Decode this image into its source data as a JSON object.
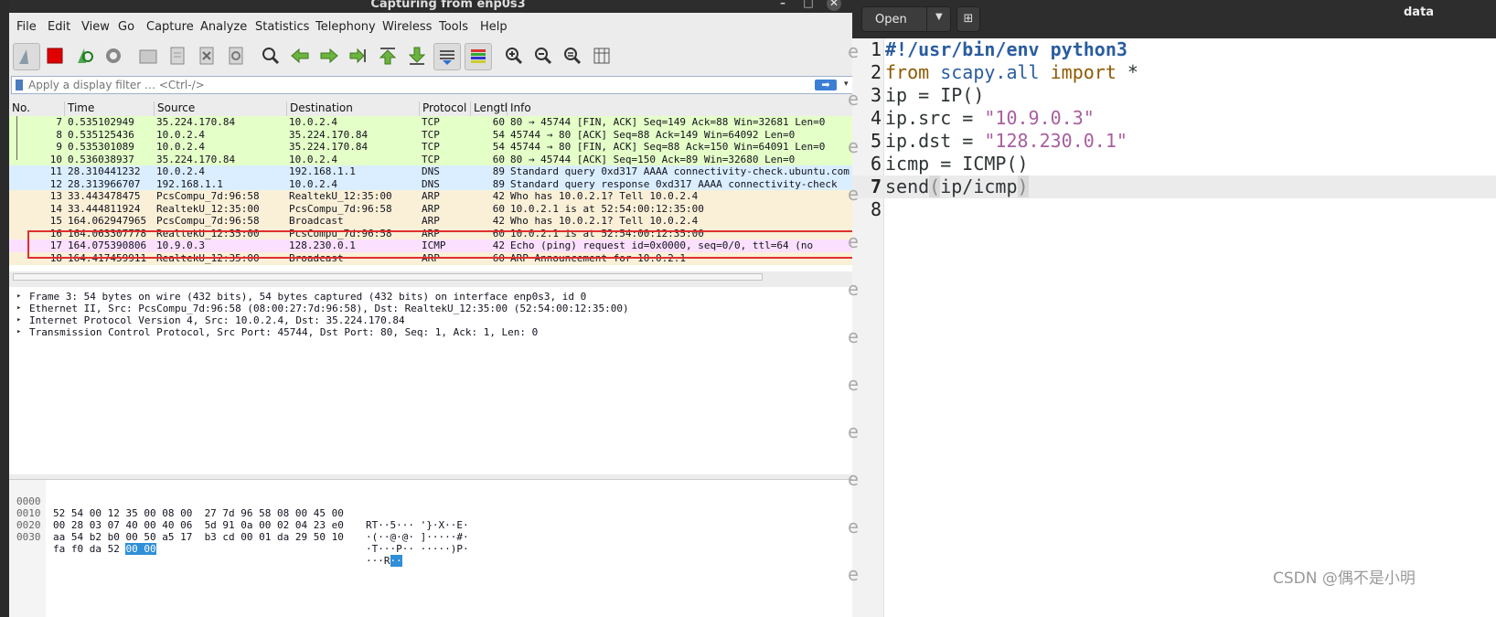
{
  "wireshark": {
    "title": "Capturing from enp0s3",
    "window_controls": {
      "minimize": "–",
      "maximize": "□",
      "close": "✕"
    },
    "menu": [
      "File",
      "Edit",
      "View",
      "Go",
      "Capture",
      "Analyze",
      "Statistics",
      "Telephony",
      "Wireless",
      "Tools",
      "Help"
    ],
    "toolbar_icons": [
      "shark-fin-start-icon",
      "stop-capture-icon",
      "restart-capture-icon",
      "capture-options-gear-icon",
      "open-file-icon",
      "save-file-icon",
      "close-file-icon",
      "reload-file-icon",
      "find-packet-icon",
      "go-back-icon",
      "go-forward-icon",
      "go-to-packet-icon",
      "go-first-icon",
      "go-last-icon",
      "autoscroll-icon",
      "colorize-icon",
      "zoom-in-icon",
      "zoom-out-icon",
      "zoom-normal-icon",
      "resize-columns-icon"
    ],
    "filter": {
      "placeholder": "Apply a display filter … <Ctrl-/>",
      "apply": "➡",
      "dropdown": "▾",
      "add": "+"
    },
    "columns": [
      "No.",
      "Time",
      "Source",
      "Destination",
      "Protocol",
      "Length",
      "Info"
    ],
    "packets": [
      {
        "no": "7",
        "time": "0.535102949",
        "src": "35.224.170.84",
        "dst": "10.0.2.4",
        "proto": "TCP",
        "len": "60",
        "info": "80 → 45744 [FIN, ACK] Seq=149 Ack=88 Win=32681 Len=0",
        "bg": "#e4ffc7"
      },
      {
        "no": "8",
        "time": "0.535125436",
        "src": "10.0.2.4",
        "dst": "35.224.170.84",
        "proto": "TCP",
        "len": "54",
        "info": "45744 → 80 [ACK] Seq=88 Ack=149 Win=64092 Len=0",
        "bg": "#e4ffc7"
      },
      {
        "no": "9",
        "time": "0.535301089",
        "src": "10.0.2.4",
        "dst": "35.224.170.84",
        "proto": "TCP",
        "len": "54",
        "info": "45744 → 80 [FIN, ACK] Seq=88 Ack=150 Win=64091 Len=0",
        "bg": "#e4ffc7"
      },
      {
        "no": "10",
        "time": "0.536038937",
        "src": "35.224.170.84",
        "dst": "10.0.2.4",
        "proto": "TCP",
        "len": "60",
        "info": "80 → 45744 [ACK] Seq=150 Ack=89 Win=32680 Len=0",
        "bg": "#e4ffc7"
      },
      {
        "no": "11",
        "time": "28.310441232",
        "src": "10.0.2.4",
        "dst": "192.168.1.1",
        "proto": "DNS",
        "len": "89",
        "info": "Standard query 0xd317 AAAA connectivity-check.ubuntu.com",
        "bg": "#daeeff"
      },
      {
        "no": "12",
        "time": "28.313966707",
        "src": "192.168.1.1",
        "dst": "10.0.2.4",
        "proto": "DNS",
        "len": "89",
        "info": "Standard query response 0xd317 AAAA connectivity-check",
        "bg": "#daeeff"
      },
      {
        "no": "13",
        "time": "33.443478475",
        "src": "PcsCompu_7d:96:58",
        "dst": "RealtekU_12:35:00",
        "proto": "ARP",
        "len": "42",
        "info": "Who has 10.0.2.1? Tell 10.0.2.4",
        "bg": "#faf0d7"
      },
      {
        "no": "14",
        "time": "33.444811924",
        "src": "RealtekU_12:35:00",
        "dst": "PcsCompu_7d:96:58",
        "proto": "ARP",
        "len": "60",
        "info": "10.0.2.1 is at 52:54:00:12:35:00",
        "bg": "#faf0d7"
      },
      {
        "no": "15",
        "time": "164.062947965",
        "src": "PcsCompu_7d:96:58",
        "dst": "Broadcast",
        "proto": "ARP",
        "len": "42",
        "info": "Who has 10.0.2.1? Tell 10.0.2.4",
        "bg": "#faf0d7"
      },
      {
        "no": "16",
        "time": "164.063307778",
        "src": "RealtekU_12:35:00",
        "dst": "PcsCompu_7d:96:58",
        "proto": "ARP",
        "len": "60",
        "info": "10.0.2.1 is at 52:54:00:12:35:00",
        "bg": "#faf0d7"
      },
      {
        "no": "17",
        "time": "164.075390806",
        "src": "10.9.0.3",
        "dst": "128.230.0.1",
        "proto": "ICMP",
        "len": "42",
        "info": "Echo (ping) request  id=0x0000, seq=0/0, ttl=64 (no",
        "bg": "#fce0ff"
      },
      {
        "no": "18",
        "time": "164.417459911",
        "src": "RealtekU_12:35:00",
        "dst": "Broadcast",
        "proto": "ARP",
        "len": "60",
        "info": "ARP Announcement for 10.0.2.1",
        "bg": "#faf0d7"
      }
    ],
    "details": [
      "Frame 3: 54 bytes on wire (432 bits), 54 bytes captured (432 bits) on interface enp0s3, id 0",
      "Ethernet II, Src: PcsCompu_7d:96:58 (08:00:27:7d:96:58), Dst: RealtekU_12:35:00 (52:54:00:12:35:00)",
      "Internet Protocol Version 4, Src: 10.0.2.4, Dst: 35.224.170.84",
      "Transmission Control Protocol, Src Port: 45744, Dst Port: 80, Seq: 1, Ack: 1, Len: 0"
    ],
    "bytes": [
      {
        "offset": "0000",
        "hex": "52 54 00 12 35 00 08 00  27 7d 96 58 08 00 45 00",
        "hex_sel": "",
        "ascii": "RT··5··· '}·X··E·",
        "ascii_sel": ""
      },
      {
        "offset": "0010",
        "hex": "00 28 03 07 40 00 40 06  5d 91 0a 00 02 04 23 e0",
        "hex_sel": "",
        "ascii": "·(··@·@· ]·····#·",
        "ascii_sel": ""
      },
      {
        "offset": "0020",
        "hex": "aa 54 b2 b0 00 50 a5 17  b3 cd 00 01 da 29 50 10",
        "hex_sel": "",
        "ascii": "·T···P·· ·····)P·",
        "ascii_sel": ""
      },
      {
        "offset": "0030",
        "hex": "fa f0 da 52 ",
        "hex_sel": "00 00",
        "ascii": "···R",
        "ascii_sel": "··"
      }
    ]
  },
  "gedit": {
    "open_label": "Open",
    "title": "data",
    "gutter_marks": [
      "e",
      "e",
      "e",
      "e",
      "e",
      "e",
      "e",
      "e",
      "e",
      "e",
      "e",
      "e"
    ],
    "lines": [
      {
        "n": "1",
        "tokens": [
          {
            "t": "#!/usr/bin/env python3",
            "c": "kw-bold"
          }
        ]
      },
      {
        "n": "2",
        "tokens": [
          {
            "t": "from",
            "c": "kw-from"
          },
          {
            "t": " ",
            "c": ""
          },
          {
            "t": "scapy.all",
            "c": "mod"
          },
          {
            "t": " ",
            "c": ""
          },
          {
            "t": "import",
            "c": "kw-from"
          },
          {
            "t": " *",
            "c": ""
          }
        ]
      },
      {
        "n": "3",
        "tokens": [
          {
            "t": "ip = IP()",
            "c": ""
          }
        ]
      },
      {
        "n": "4",
        "tokens": [
          {
            "t": "ip.src = ",
            "c": ""
          },
          {
            "t": "\"10.9.0.3\"",
            "c": "str"
          }
        ]
      },
      {
        "n": "5",
        "tokens": [
          {
            "t": "ip.dst = ",
            "c": ""
          },
          {
            "t": "\"128.230.0.1\"",
            "c": "str"
          }
        ]
      },
      {
        "n": "6",
        "tokens": [
          {
            "t": "icmp = ICMP()",
            "c": ""
          }
        ]
      },
      {
        "n": "7",
        "tokens": [
          {
            "t": "send",
            "c": ""
          },
          {
            "t": "(",
            "c": "paren-m"
          },
          {
            "t": "ip/icmp",
            "c": ""
          },
          {
            "t": ")",
            "c": "paren-m"
          }
        ]
      },
      {
        "n": "8",
        "tokens": []
      }
    ],
    "current_line": "7"
  },
  "watermark": "CSDN @偶不是小明"
}
